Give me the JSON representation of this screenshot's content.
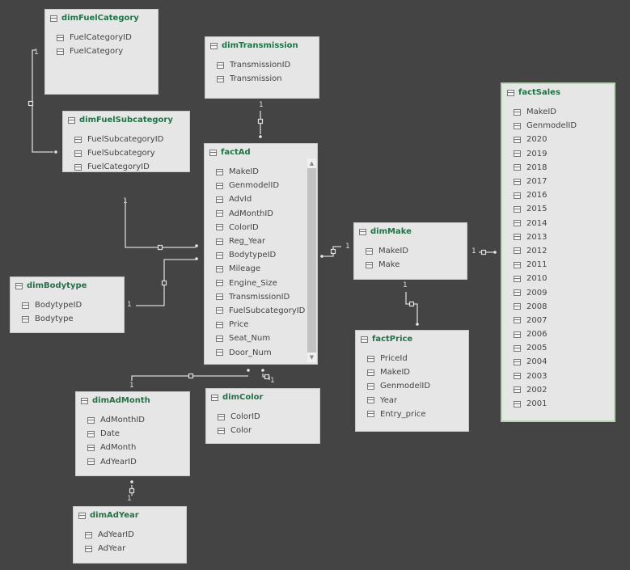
{
  "tables": {
    "dimFuelCategory": {
      "title": "dimFuelCategory",
      "columns": [
        "FuelCategoryID",
        "FuelCategory"
      ]
    },
    "dimTransmission": {
      "title": "dimTransmission",
      "columns": [
        "TransmissionID",
        "Transmission"
      ]
    },
    "dimFuelSubcategory": {
      "title": "dimFuelSubcategory",
      "columns": [
        "FuelSubcategoryID",
        "FuelSubcategory",
        "FuelCategoryID"
      ]
    },
    "factAd": {
      "title": "factAd",
      "columns": [
        "MakeID",
        "GenmodelID",
        "AdvId",
        "AdMonthID",
        "ColorID",
        "Reg_Year",
        "BodytypeID",
        "Mileage",
        "Engine_Size",
        "TransmissionID",
        "FuelSubcategoryID",
        "Price",
        "Seat_Num",
        "Door_Num"
      ]
    },
    "dimMake": {
      "title": "dimMake",
      "columns": [
        "MakeID",
        "Make"
      ]
    },
    "factSales": {
      "title": "factSales",
      "columns": [
        "MakeID",
        "GenmodelID",
        "2020",
        "2019",
        "2018",
        "2017",
        "2016",
        "2015",
        "2014",
        "2013",
        "2012",
        "2011",
        "2010",
        "2009",
        "2008",
        "2007",
        "2006",
        "2005",
        "2004",
        "2003",
        "2002",
        "2001"
      ]
    },
    "dimBodytype": {
      "title": "dimBodytype",
      "columns": [
        "BodytypeID",
        "Bodytype"
      ]
    },
    "factPrice": {
      "title": "factPrice",
      "columns": [
        "PriceId",
        "MakeID",
        "GenmodelID",
        "Year",
        "Entry_price"
      ]
    },
    "dimAdMonth": {
      "title": "dimAdMonth",
      "columns": [
        "AdMonthID",
        "Date",
        "AdMonth",
        "AdYearID"
      ]
    },
    "dimColor": {
      "title": "dimColor",
      "columns": [
        "ColorID",
        "Color"
      ]
    },
    "dimAdYear": {
      "title": "dimAdYear",
      "columns": [
        "AdYearID",
        "AdYear"
      ]
    }
  },
  "cardinality_one": "1",
  "colors": {
    "background": "#444444",
    "table": "#e6e6e6",
    "title": "#217346",
    "line": "#d8d8d8"
  }
}
